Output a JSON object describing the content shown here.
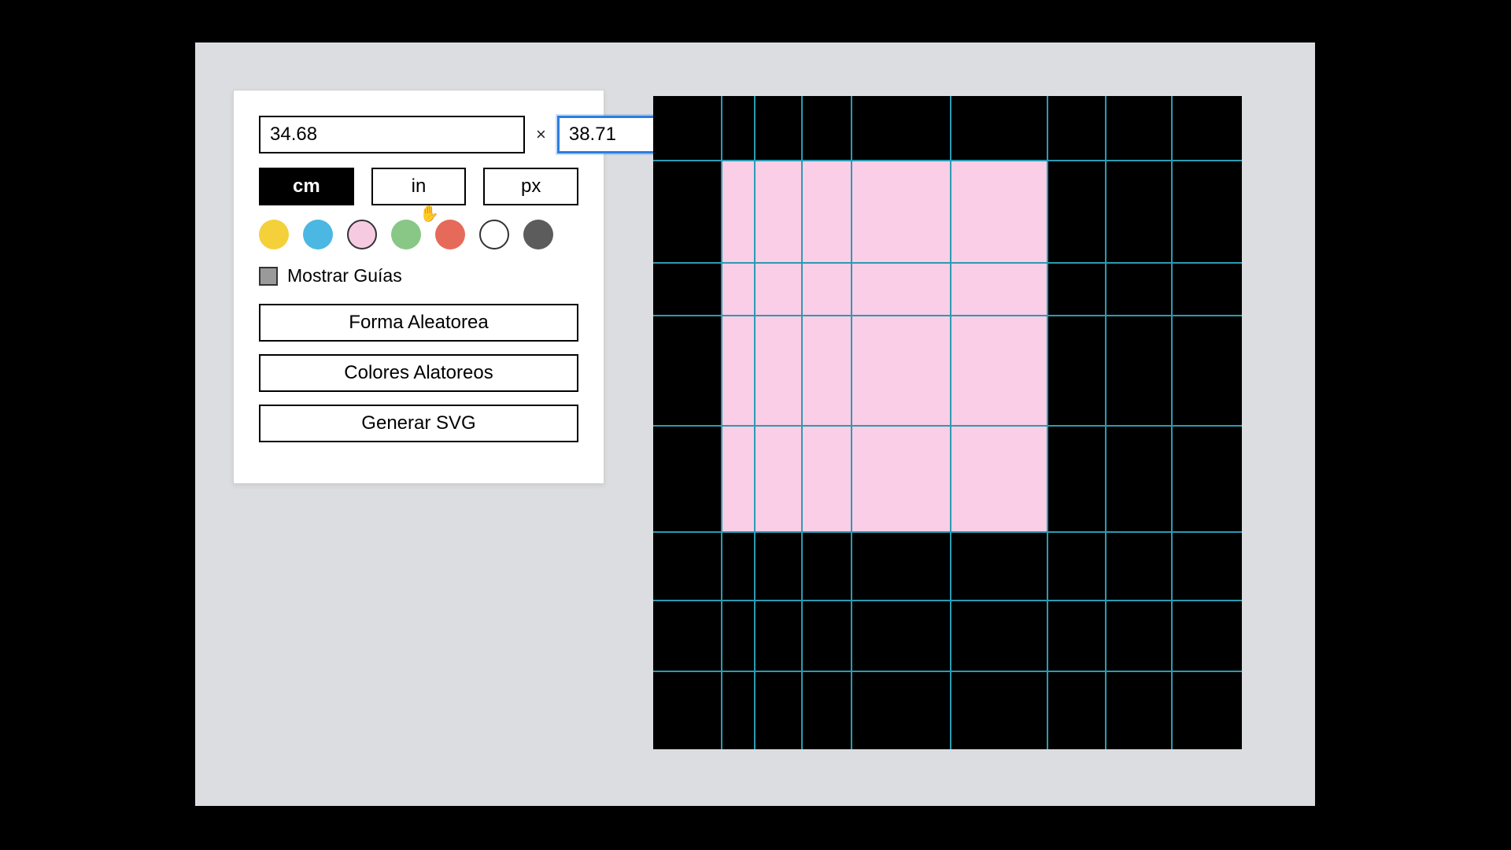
{
  "dimensions": {
    "width_value": "34.68",
    "height_value": "38.71",
    "separator": "×"
  },
  "units": {
    "cm": "cm",
    "in": "in",
    "px": "px",
    "active": "cm"
  },
  "colors": {
    "yellow": "#f4d13b",
    "cyan": "#4bb7e3",
    "pink": "#f6cbe1",
    "green": "#88c786",
    "coral": "#e66a5a",
    "white": "#ffffff",
    "gray": "#5c5c5c",
    "selected": "pink"
  },
  "guides": {
    "label": "Mostrar Guías",
    "checked": true
  },
  "buttons": {
    "random_shape": "Forma Aleatorea",
    "random_colors": "Colores Alatoreos",
    "generate_svg": "Generar SVG"
  },
  "canvas": {
    "background": "#000000",
    "shape_color": "#f9cee6",
    "guide_color": "#2b9bb3",
    "v_guides_pct": [
      11.5,
      17.1,
      25.1,
      33.5,
      50.4,
      66.8,
      76.7,
      88.0
    ],
    "h_guides_pct": [
      9.7,
      25.4,
      33.5,
      50.4,
      66.6,
      77.1,
      88.0
    ]
  }
}
